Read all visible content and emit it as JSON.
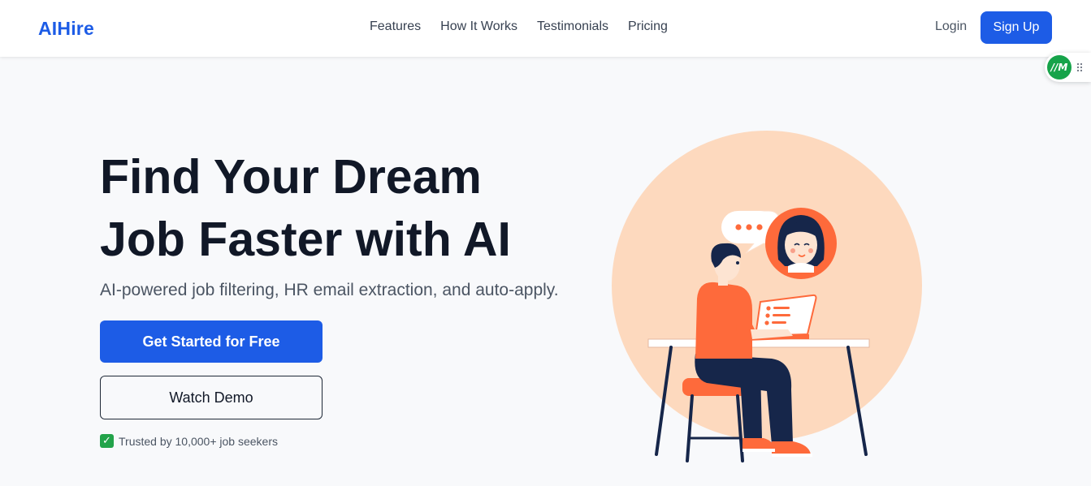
{
  "brand": {
    "name": "AIHire",
    "color": "#1d5ce6"
  },
  "nav": {
    "links": [
      {
        "label": "Features"
      },
      {
        "label": "How It Works"
      },
      {
        "label": "Testimonials"
      },
      {
        "label": "Pricing"
      }
    ],
    "login_label": "Login",
    "signup_label": "Sign Up"
  },
  "extension": {
    "badge_text": "//M",
    "color": "#16a34a"
  },
  "hero": {
    "title_line1": "Find Your Dream",
    "title_line2": "Job Faster with AI",
    "subtitle": "AI-powered job filtering, HR email extraction, and auto-apply.",
    "cta_primary": "Get Started for Free",
    "cta_secondary": "Watch Demo",
    "trust_icon": "✓",
    "trust_text": "Trusted by 10,000+ job seekers"
  },
  "illustration": {
    "icon": "person-at-laptop-chatting-illustration",
    "accent": "#fe6a3b",
    "backdrop": "#fdd9be",
    "navy": "#16264a"
  }
}
